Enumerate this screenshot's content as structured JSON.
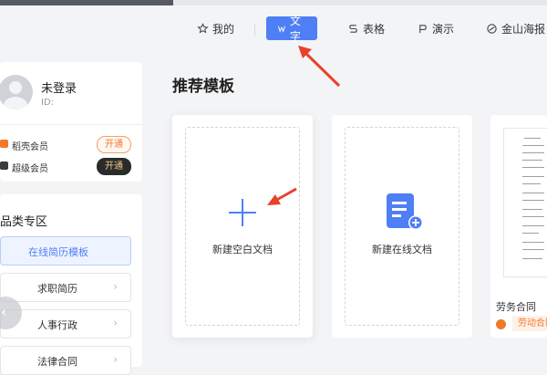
{
  "nav": {
    "mine": "我的",
    "text": "文字",
    "sheet": "表格",
    "slides": "演示",
    "poster": "金山海报"
  },
  "user": {
    "name": "未登录",
    "id_label": "ID:"
  },
  "membership": [
    {
      "label": "稻壳会员",
      "button": "开通",
      "icon_color": "#f07a2a"
    },
    {
      "label": "超级会员",
      "button": "开通",
      "icon_color": "#333333"
    }
  ],
  "category": {
    "title": "品类专区",
    "items": [
      "在线简历模板",
      "求职简历",
      "人事行政",
      "法律合同"
    ]
  },
  "main": {
    "title": "推荐模板",
    "cards": [
      "新建空白文档",
      "新建在线文档"
    ],
    "template_title": "劳务合同",
    "template_tag": "劳动合同"
  },
  "colors": {
    "accent": "#4f7ff5",
    "arrow": "#e8412c"
  }
}
